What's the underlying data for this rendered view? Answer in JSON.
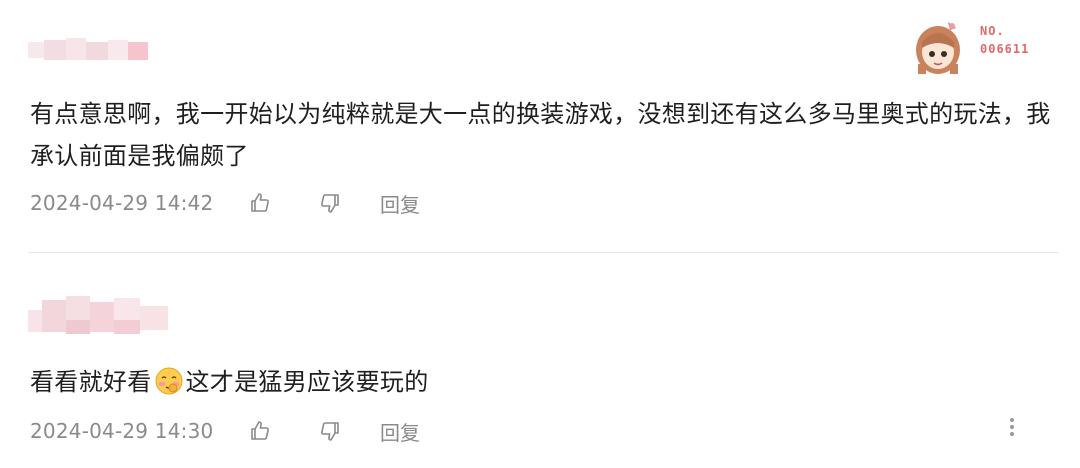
{
  "comments": [
    {
      "text": "有点意思啊，我一开始以为纯粹就是大一点的换装游戏，没想到还有这么多马里奥式的玩法，我承认前面是我偏颇了",
      "time": "2024-04-29 14:42",
      "reply_label": "回复",
      "badge_line1": "NO.",
      "badge_line2": "006611",
      "icons": [
        "thumbs-up-icon",
        "thumbs-down-icon"
      ]
    },
    {
      "text_before": "看看就好看",
      "text_after": "这才是猛男应该要玩的",
      "emoji": "shy-face-emoji",
      "time": "2024-04-29 14:30",
      "reply_label": "回复",
      "icons": [
        "thumbs-up-icon",
        "thumbs-down-icon",
        "more-vertical-icon"
      ]
    }
  ],
  "colors": {
    "text": "#1f1f1f",
    "meta": "#8a8a8a",
    "badge": "#e06a6a",
    "divider": "#e6e6e6"
  }
}
